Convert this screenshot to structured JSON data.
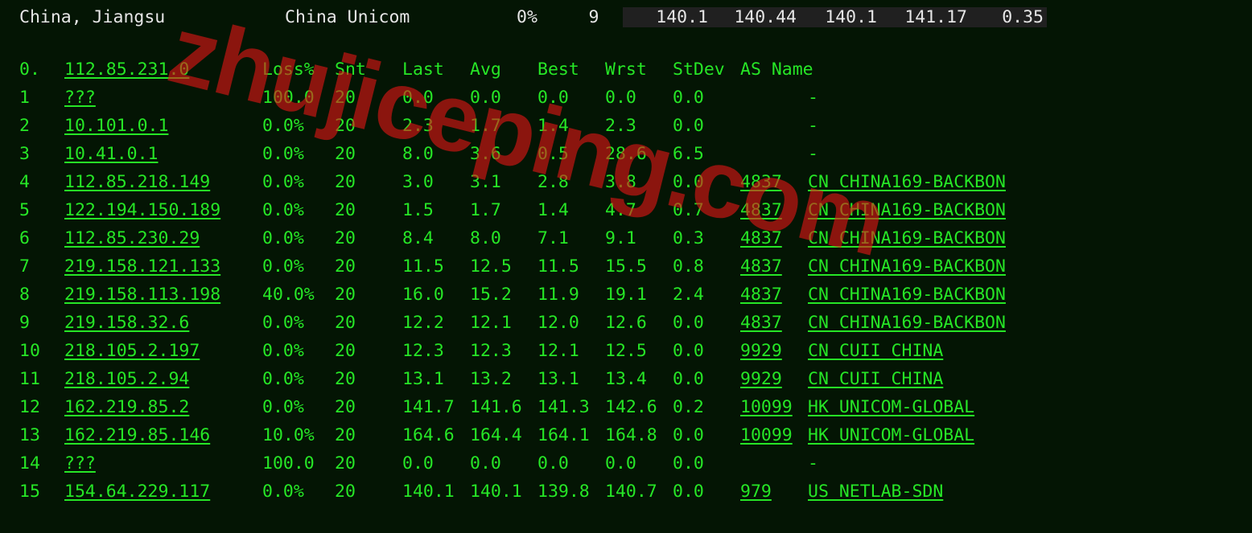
{
  "watermark": "zhujiceping.com",
  "header": {
    "location": "China, Jiangsu",
    "isp": "China Unicom",
    "loss": "0%",
    "count": "9",
    "n1": "140.1",
    "n2": "140.44",
    "n3": "140.1",
    "n4": "141.17",
    "n5": "0.35"
  },
  "columns": {
    "hop": "0.",
    "host": "112.85.231.0",
    "loss": "Loss%",
    "snt": "Snt",
    "last": "Last",
    "avg": "Avg",
    "best": "Best",
    "wrst": "Wrst",
    "stdev": "StDev",
    "asname": "AS Name"
  },
  "rows": [
    {
      "hop": "1",
      "host": "???",
      "loss": "100.0",
      "snt": "20",
      "last": "0.0",
      "avg": "0.0",
      "best": "0.0",
      "wrst": "0.0",
      "stdev": "0.0",
      "as": "",
      "asname": "-",
      "ul": true,
      "asul": false
    },
    {
      "hop": "2",
      "host": "10.101.0.1",
      "loss": "0.0%",
      "snt": "20",
      "last": "2.3",
      "avg": "1.7",
      "best": "1.4",
      "wrst": "2.3",
      "stdev": "0.0",
      "as": "",
      "asname": "-",
      "ul": true,
      "asul": false
    },
    {
      "hop": "3",
      "host": "10.41.0.1",
      "loss": "0.0%",
      "snt": "20",
      "last": "8.0",
      "avg": "3.6",
      "best": "0.5",
      "wrst": "28.6",
      "stdev": "6.5",
      "as": "",
      "asname": "-",
      "ul": true,
      "asul": false
    },
    {
      "hop": "4",
      "host": "112.85.218.149",
      "loss": "0.0%",
      "snt": "20",
      "last": "3.0",
      "avg": "3.1",
      "best": "2.8",
      "wrst": "3.8",
      "stdev": "0.0",
      "as": "4837",
      "asname": "CN CHINA169-BACKBON",
      "ul": true,
      "asul": true
    },
    {
      "hop": "5",
      "host": "122.194.150.189",
      "loss": "0.0%",
      "snt": "20",
      "last": "1.5",
      "avg": "1.7",
      "best": "1.4",
      "wrst": "4.7",
      "stdev": "0.7",
      "as": "4837",
      "asname": "CN CHINA169-BACKBON",
      "ul": true,
      "asul": true
    },
    {
      "hop": "6",
      "host": "112.85.230.29",
      "loss": "0.0%",
      "snt": "20",
      "last": "8.4",
      "avg": "8.0",
      "best": "7.1",
      "wrst": "9.1",
      "stdev": "0.3",
      "as": "4837",
      "asname": "CN CHINA169-BACKBON",
      "ul": true,
      "asul": true
    },
    {
      "hop": "7",
      "host": "219.158.121.133",
      "loss": "0.0%",
      "snt": "20",
      "last": "11.5",
      "avg": "12.5",
      "best": "11.5",
      "wrst": "15.5",
      "stdev": "0.8",
      "as": "4837",
      "asname": "CN CHINA169-BACKBON",
      "ul": true,
      "asul": true
    },
    {
      "hop": "8",
      "host": "219.158.113.198",
      "loss": "40.0%",
      "snt": "20",
      "last": "16.0",
      "avg": "15.2",
      "best": "11.9",
      "wrst": "19.1",
      "stdev": "2.4",
      "as": "4837",
      "asname": "CN CHINA169-BACKBON",
      "ul": true,
      "asul": true
    },
    {
      "hop": "9",
      "host": "219.158.32.6",
      "loss": "0.0%",
      "snt": "20",
      "last": "12.2",
      "avg": "12.1",
      "best": "12.0",
      "wrst": "12.6",
      "stdev": "0.0",
      "as": "4837",
      "asname": "CN CHINA169-BACKBON",
      "ul": true,
      "asul": true
    },
    {
      "hop": "10",
      "host": "218.105.2.197",
      "loss": "0.0%",
      "snt": "20",
      "last": "12.3",
      "avg": "12.3",
      "best": "12.1",
      "wrst": "12.5",
      "stdev": "0.0",
      "as": "9929",
      "asname": "CN CUII CHINA",
      "ul": true,
      "asul": true
    },
    {
      "hop": "11",
      "host": "218.105.2.94",
      "loss": "0.0%",
      "snt": "20",
      "last": "13.1",
      "avg": "13.2",
      "best": "13.1",
      "wrst": "13.4",
      "stdev": "0.0",
      "as": "9929",
      "asname": "CN CUII CHINA",
      "ul": true,
      "asul": true
    },
    {
      "hop": "12",
      "host": "162.219.85.2",
      "loss": "0.0%",
      "snt": "20",
      "last": "141.7",
      "avg": "141.6",
      "best": "141.3",
      "wrst": "142.6",
      "stdev": "0.2",
      "as": "10099",
      "asname": "HK UNICOM-GLOBAL",
      "ul": true,
      "asul": true
    },
    {
      "hop": "13",
      "host": "162.219.85.146",
      "loss": "10.0%",
      "snt": "20",
      "last": "164.6",
      "avg": "164.4",
      "best": "164.1",
      "wrst": "164.8",
      "stdev": "0.0",
      "as": "10099",
      "asname": "HK UNICOM-GLOBAL",
      "ul": true,
      "asul": true
    },
    {
      "hop": "14",
      "host": "???",
      "loss": "100.0",
      "snt": "20",
      "last": "0.0",
      "avg": "0.0",
      "best": "0.0",
      "wrst": "0.0",
      "stdev": "0.0",
      "as": "",
      "asname": "-",
      "ul": true,
      "asul": false
    },
    {
      "hop": "15",
      "host": "154.64.229.117",
      "loss": "0.0%",
      "snt": "20",
      "last": "140.1",
      "avg": "140.1",
      "best": "139.8",
      "wrst": "140.7",
      "stdev": "0.0",
      "as": "979",
      "asname": "US NETLAB-SDN",
      "ul": true,
      "asul": true
    }
  ]
}
